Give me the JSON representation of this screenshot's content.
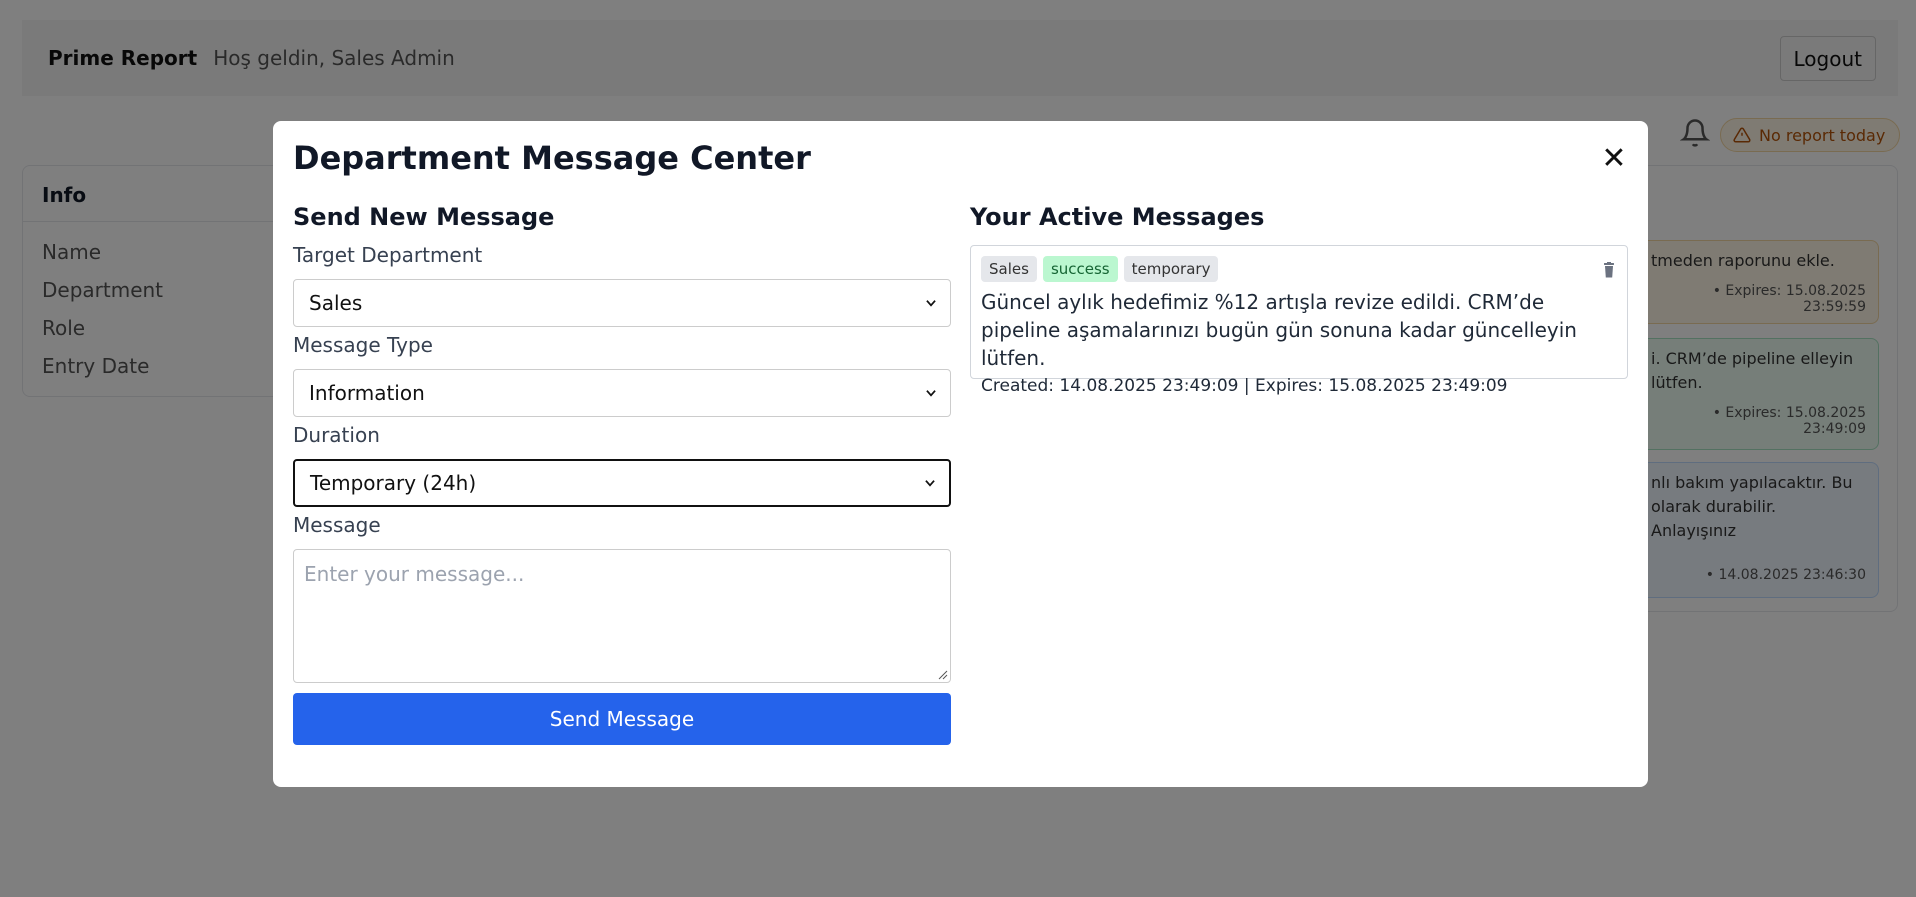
{
  "header": {
    "brand": "Prime Report",
    "welcome": "Hoş geldin, Sales Admin",
    "logout_label": "Logout"
  },
  "status": {
    "notification_icon": "bell-icon",
    "warning_icon": "warning-triangle-icon",
    "warning_text": "No report today"
  },
  "info_card": {
    "title": "Info",
    "rows": [
      "Name",
      "Department",
      "Role",
      "Entry Date"
    ]
  },
  "background_messages": [
    {
      "text": "tmeden raporunu ekle.",
      "meta": "• Expires: 15.08.2025 23:59:59"
    },
    {
      "text": "i. CRM’de pipeline elleyin lütfen.",
      "meta": "• Expires: 15.08.2025 23:49:09"
    },
    {
      "text": "nlı bakım yapılacaktır. Bu olarak durabilir. Anlayışınız",
      "meta": "• 14.08.2025 23:46:30"
    }
  ],
  "modal": {
    "title": "Department Message Center",
    "close_icon": "close-icon",
    "send_section": {
      "title": "Send New Message",
      "target_label": "Target Department",
      "target_value": "Sales",
      "type_label": "Message Type",
      "type_value": "Information",
      "duration_label": "Duration",
      "duration_value": "Temporary (24h)",
      "message_label": "Message",
      "message_placeholder": "Enter your message...",
      "send_label": "Send Message"
    },
    "active_section": {
      "title": "Your Active Messages",
      "messages": [
        {
          "tags": [
            "Sales",
            "success",
            "temporary"
          ],
          "text": "Güncel aylık hedefimiz %12 artışla revize edildi. CRM’de pipeline aşamalarınızı bugün gün sonuna kadar güncelleyin lütfen.",
          "meta": "Created: 14.08.2025 23:49:09 | Expires: 15.08.2025 23:49:09",
          "delete_icon": "trash-icon"
        }
      ]
    }
  },
  "colors": {
    "primary_button": "#2563eb",
    "success_tag": "#bbf7d0",
    "warning_text": "#b45309",
    "overlay": "rgba(0,0,0,0.5)"
  }
}
